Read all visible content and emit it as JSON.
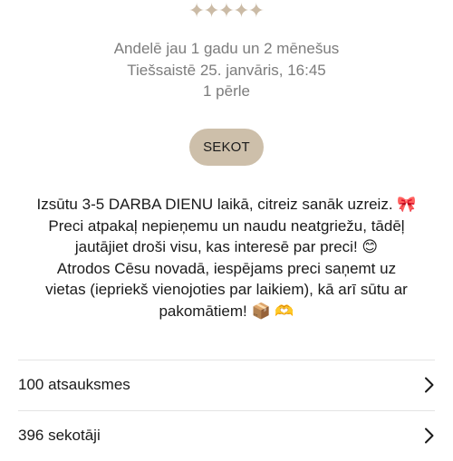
{
  "rating": {
    "icon": "sparkle-star-icon",
    "count": 5,
    "color": "#cbbba6"
  },
  "profile": {
    "member_since": "Andelē jau 1 gadu un 2 mēnešus",
    "last_online": "Tiešsaistē 25. janvāris, 16:45",
    "pearls": "1 pērle"
  },
  "follow_button": {
    "label": "SEKOT",
    "color": "#cdbfaa"
  },
  "bio": {
    "lines": [
      "Izsūtu 3-5 DARBA DIENU laikā, citreiz sanāk uzreiz. 🎀",
      "Preci atpakaļ nepieņemu un naudu neatgriežu, tādēļ",
      "jautājiet droši visu, kas interesē par preci! 😊",
      "Atrodos Cēsu novadā, iespējams preci saņemt uz",
      "vietas (iepriekš vienojoties par laikiem), kā arī sūtu ar",
      "pakomātiem! 📦 🫶"
    ]
  },
  "links": [
    {
      "label": "100 atsauksmes",
      "icon": "chevron-right-icon"
    },
    {
      "label": "396 sekotāji",
      "icon": "chevron-right-icon"
    }
  ]
}
